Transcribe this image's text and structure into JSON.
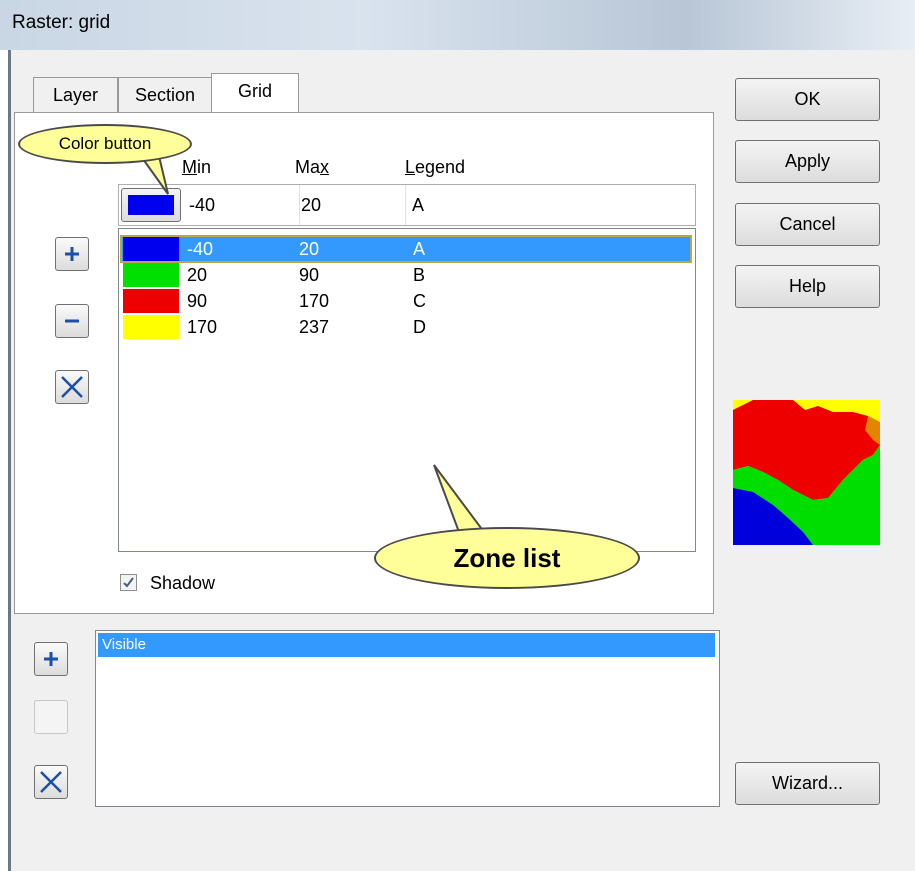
{
  "window": {
    "title": "Raster: grid"
  },
  "tabs": [
    {
      "label": "Layer"
    },
    {
      "label": "Section"
    },
    {
      "label": "Grid",
      "active": true
    }
  ],
  "buttons": {
    "ok": "OK",
    "apply": "Apply",
    "cancel": "Cancel",
    "help": "Help",
    "wizard": "Wizard..."
  },
  "columns": {
    "min_pre": "",
    "min_ul": "M",
    "min_post": "in",
    "max_pre": "Ma",
    "max_ul": "x",
    "max_post": "",
    "legend_pre": "",
    "legend_ul": "L",
    "legend_post": "egend"
  },
  "editor": {
    "color": "#0000ee",
    "min": "-40",
    "max": "20",
    "legend": "A"
  },
  "zones": [
    {
      "color": "#0000ee",
      "min": "-40",
      "max": "20",
      "legend": "A",
      "selected": true
    },
    {
      "color": "#00e000",
      "min": "20",
      "max": "90",
      "legend": "B"
    },
    {
      "color": "#ee0000",
      "min": "90",
      "max": "170",
      "legend": "C"
    },
    {
      "color": "#ffff00",
      "min": "170",
      "max": "237",
      "legend": "D"
    }
  ],
  "shadow": {
    "label": "Shadow",
    "checked": true
  },
  "visible_list": {
    "items": [
      "Visible"
    ]
  },
  "callouts": {
    "color_button": "Color button",
    "zone_list": "Zone list"
  },
  "colors": {
    "selection": "#3399ff",
    "callout": "#ffff99"
  }
}
